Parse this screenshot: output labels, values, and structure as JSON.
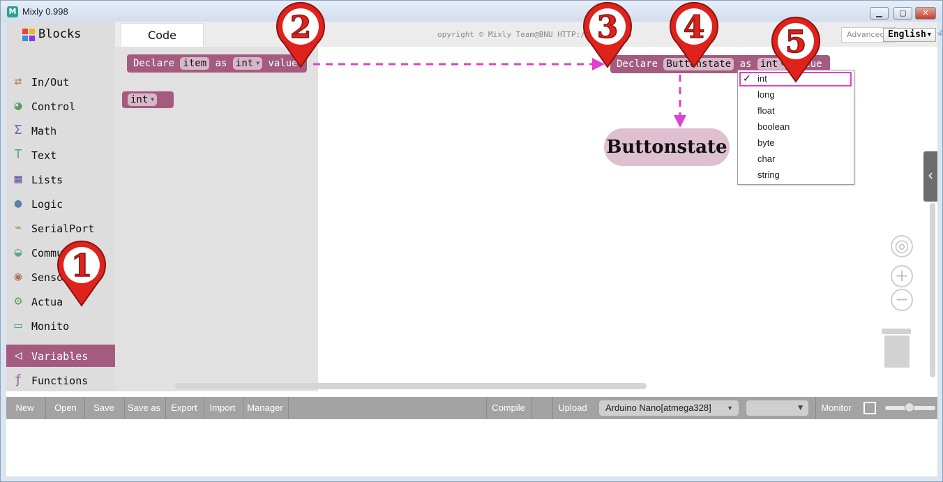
{
  "window": {
    "title": "Mixly 0.998",
    "app_icon": "M"
  },
  "header": {
    "blocks_label": "Blocks",
    "code_tab": "Code",
    "copyright": "opyright © Mixly Team@BNU HTTP://MIXLY.ORG",
    "advanced": "Advanced",
    "language": "English"
  },
  "categories": [
    {
      "label": "In/Out",
      "icon": "arrows-icon",
      "color": "#b27b4e"
    },
    {
      "label": "Control",
      "icon": "gamepad-icon",
      "color": "#5a9e5a"
    },
    {
      "label": "Math",
      "icon": "sigma-icon",
      "color": "#5b67a5"
    },
    {
      "label": "Text",
      "icon": "text-t-icon",
      "color": "#5ba58c"
    },
    {
      "label": "Lists",
      "icon": "lists-icon",
      "color": "#745ba5"
    },
    {
      "label": "Logic",
      "icon": "bulb-icon",
      "color": "#5b80a5"
    },
    {
      "label": "SerialPort",
      "icon": "usb-plug-icon",
      "color": "#8ba55b"
    },
    {
      "label": "Communicate",
      "icon": "satellite-icon",
      "color": "#5ba580"
    },
    {
      "label": "Sensor",
      "icon": "radar-icon",
      "color": "#a5745b"
    },
    {
      "label": "Actua",
      "icon": "motor-icon",
      "color": "#5ba55b"
    },
    {
      "label": "Monito",
      "icon": "monitor-icon",
      "color": "#5b99a5"
    },
    {
      "label": "Variables",
      "icon": "unity-icon",
      "color": "#a55b80"
    },
    {
      "label": "Functions",
      "icon": "function-xy-icon",
      "color": "#995ba5"
    }
  ],
  "flyout": {
    "declare_block": {
      "declare": "Declare",
      "name": "item",
      "as": "as",
      "type": "int",
      "value": "value"
    },
    "type_block": {
      "type": "int"
    }
  },
  "workspace": {
    "declare_block": {
      "declare": "Declare",
      "name": "Buttonstate",
      "as": "as",
      "type": "int",
      "value": "value"
    },
    "bubble": "Buttonstate"
  },
  "dropdown": {
    "selected": "int",
    "options": [
      "int",
      "long",
      "float",
      "boolean",
      "byte",
      "char",
      "string"
    ]
  },
  "annotations": [
    "1",
    "2",
    "3",
    "4",
    "5"
  ],
  "toolbar": {
    "new": "New",
    "open": "Open",
    "save": "Save",
    "save_as": "Save as",
    "export": "Export",
    "import": "Import",
    "manager": "Manager",
    "compile": "Compile",
    "upload": "Upload",
    "board": "Arduino Nano[atmega328]",
    "monitor": "Monitor"
  },
  "colors": {
    "variables": "#a55b80",
    "annotation_red": "#e0221c",
    "arrow_magenta": "#e23fd0"
  }
}
